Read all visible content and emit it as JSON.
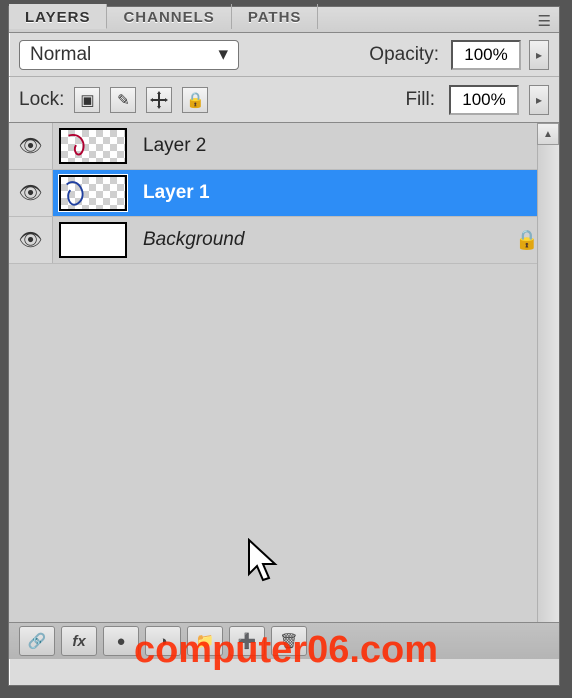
{
  "tabs": {
    "layers": "LAYERS",
    "channels": "CHANNELS",
    "paths": "PATHS"
  },
  "blend": {
    "mode": "Normal",
    "opacity_label": "Opacity:",
    "opacity_value": "100%"
  },
  "lock": {
    "label": "Lock:",
    "fill_label": "Fill:",
    "fill_value": "100%"
  },
  "layers": [
    {
      "name": "Layer 2",
      "selected": false,
      "locked": false,
      "thumb_style": "checker-scribble"
    },
    {
      "name": "Layer 1",
      "selected": true,
      "locked": false,
      "thumb_style": "checker-scribble"
    },
    {
      "name": "Background",
      "selected": false,
      "locked": true,
      "thumb_style": "white",
      "italic": true
    }
  ],
  "icons": {
    "panel_menu": "☰",
    "dropdown_arrow": "▾",
    "slider_arrow": "▸",
    "lock_transparent": "▣",
    "lock_brush": "✎",
    "lock_full": "🔒",
    "eye": "👁",
    "scroll_up": "▲",
    "link": "🔗",
    "fx": "fx",
    "mask": "●",
    "adjustment": "◑",
    "folder": "📁",
    "new_layer": "➕",
    "trash": "🗑"
  },
  "watermark": "computer06.com",
  "colors": {
    "selection": "#2d8df6",
    "watermark": "#ff2a00",
    "panel_bg": "#dcdcdc"
  }
}
